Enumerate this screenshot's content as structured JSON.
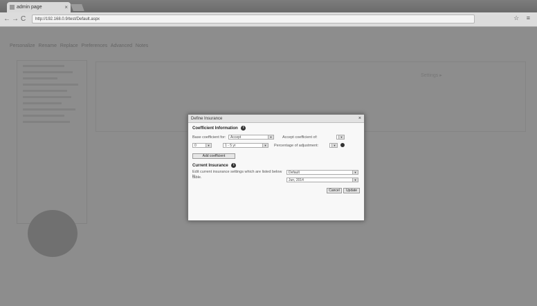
{
  "browser": {
    "tab_title": "admin page",
    "tab_close": "×",
    "url": "http://192.168.0.9/test/Default.aspx",
    "back": "←",
    "forward": "→",
    "reload": "C",
    "right_icons": "☆ ≡"
  },
  "app": {
    "menu": "Personalize Rename Replace Preferences Advanced Notes",
    "right_link": "Settings ▸"
  },
  "dialog": {
    "title": "Define Insurance",
    "close": "×",
    "section1": {
      "title": "Coefficient Information",
      "info": "i",
      "label1": "Base coefficient for:",
      "select1": "Accept",
      "label2": "Accept coefficient of:",
      "select3_value": "0",
      "select4_value": "1 - 5 yr",
      "label3": "Percentage of adjustment:",
      "add_button": "Add coefficient"
    },
    "section2": {
      "title": "Current Insurance",
      "info": "i",
      "description": "Edit current insurance settings which are listed below in",
      "description2": "table.",
      "select1": "Default",
      "select2": "Jun, 2014"
    },
    "buttons": {
      "cancel": "Cancel",
      "ok": "Update"
    }
  }
}
